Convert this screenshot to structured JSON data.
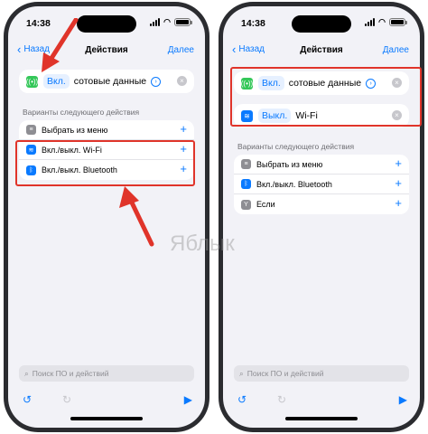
{
  "status": {
    "time": "14:38"
  },
  "colors": {
    "accent": "#0a7aff",
    "highlight": "#e0342a",
    "cellular": "#34c759"
  },
  "left": {
    "nav": {
      "back": "Назад",
      "title": "Действия",
      "next": "Далее"
    },
    "action": {
      "chip": "Вкл.",
      "text": "сотовые данные"
    },
    "section_label": "Варианты следующего действия",
    "suggestions": [
      {
        "label": "Выбрать из меню",
        "icon": "menu-icon"
      },
      {
        "label": "Вкл./выкл. Wi-Fi",
        "icon": "wifi-icon"
      },
      {
        "label": "Вкл./выкл. Bluetooth",
        "icon": "bluetooth-icon"
      }
    ],
    "search_placeholder": "Поиск ПО и действий"
  },
  "right": {
    "nav": {
      "back": "Назад",
      "title": "Действия",
      "next": "Далее"
    },
    "actions": [
      {
        "chip": "Вкл.",
        "text": "сотовые данные"
      },
      {
        "chip": "Выкл.",
        "text": "Wi-Fi"
      }
    ],
    "section_label": "Варианты следующего действия",
    "suggestions": [
      {
        "label": "Выбрать из меню",
        "icon": "menu-icon"
      },
      {
        "label": "Вкл./выкл. Bluetooth",
        "icon": "bluetooth-icon"
      },
      {
        "label": "Если",
        "icon": "if-icon"
      }
    ],
    "search_placeholder": "Поиск ПО и действий"
  },
  "watermark": "Яблык"
}
